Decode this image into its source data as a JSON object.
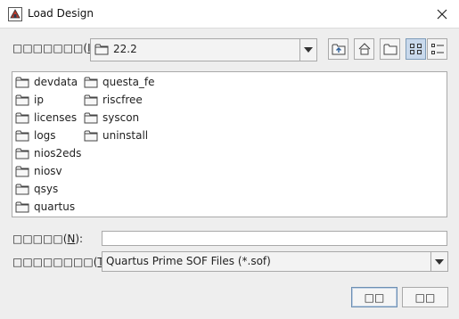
{
  "window": {
    "title": "Load Design"
  },
  "look_in": {
    "label_text": "□□□□□□□",
    "label_open": "(",
    "mnemonic": "I",
    "label_close": "):",
    "selected_value": "22.2"
  },
  "toolbar": {
    "up_icon": "up-one-level-icon",
    "home_icon": "home-icon",
    "new_folder_icon": "new-folder-icon",
    "list_view_icon": "list-view-icon",
    "details_view_icon": "details-view-icon"
  },
  "files": [
    {
      "name": "devdata",
      "icon": "folder-icon"
    },
    {
      "name": "ip",
      "icon": "folder-icon"
    },
    {
      "name": "licenses",
      "icon": "folder-icon"
    },
    {
      "name": "logs",
      "icon": "folder-icon"
    },
    {
      "name": "nios2eds",
      "icon": "folder-icon"
    },
    {
      "name": "niosv",
      "icon": "folder-icon"
    },
    {
      "name": "qsys",
      "icon": "folder-icon"
    },
    {
      "name": "quartus",
      "icon": "folder-icon"
    },
    {
      "name": "questa_fe",
      "icon": "folder-icon"
    },
    {
      "name": "riscfree",
      "icon": "folder-icon"
    },
    {
      "name": "syscon",
      "icon": "folder-icon"
    },
    {
      "name": "uninstall",
      "icon": "folder-icon"
    }
  ],
  "file_name": {
    "label_text": "□□□□□",
    "label_open": "(",
    "mnemonic": "N",
    "label_close": "):",
    "value": ""
  },
  "file_type": {
    "label_text": "□□□□□□□□",
    "label_open": "(",
    "mnemonic": "T",
    "label_close": "):",
    "selected_value": "Quartus Prime SOF Files (*.sof)"
  },
  "buttons": {
    "ok_label": "□□",
    "cancel_label": "□□"
  }
}
